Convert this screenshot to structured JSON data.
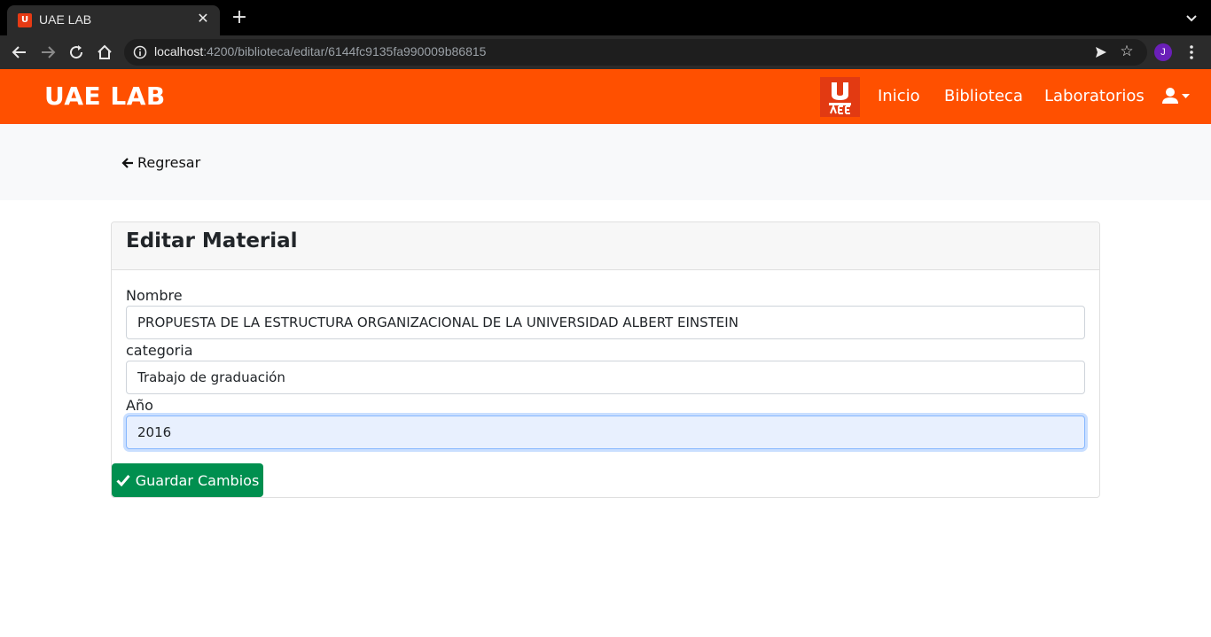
{
  "browser": {
    "tab_title": "UAE LAB",
    "favicon_label": "U",
    "url_host": "localhost",
    "url_rest": ":4200/biblioteca/editar/6144fc9135fa990009b86815",
    "profile_initial": "J"
  },
  "navbar": {
    "brand": "UAE LAB",
    "links": [
      "Inicio",
      "Biblioteca",
      "Laboratorios"
    ],
    "brand_color": "#ff5000"
  },
  "back": {
    "label": "Regresar"
  },
  "card": {
    "title": "Editar Material",
    "fields": [
      {
        "label": "Nombre",
        "value": "PROPUESTA DE LA ESTRUCTURA ORGANIZACIONAL DE LA UNIVERSIDAD ALBERT EINSTEIN"
      },
      {
        "label": "categoria",
        "value": "Trabajo de graduación"
      },
      {
        "label": "Año",
        "value": "2016"
      }
    ],
    "save_label": "Guardar Cambios",
    "save_color": "#008f4f"
  }
}
